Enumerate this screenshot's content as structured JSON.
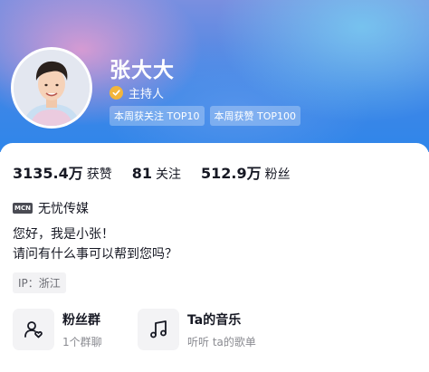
{
  "profile": {
    "name": "张大大",
    "verified_label": "主持人",
    "tags": [
      "本周获关注 TOP10",
      "本周获赞 TOP100"
    ]
  },
  "stats": [
    {
      "value": "3135.4万",
      "label": "获赞"
    },
    {
      "value": "81",
      "label": "关注"
    },
    {
      "value": "512.9万",
      "label": "粉丝"
    }
  ],
  "org": {
    "icon_text": "MCN",
    "name": "无忧传媒"
  },
  "bio": {
    "line1": "您好，我是小张！",
    "line2": "请问有什么事可以帮到您吗？"
  },
  "ip": "IP：浙江",
  "entries": [
    {
      "title": "粉丝群",
      "subtitle": "1个群聊",
      "icon": "fan-group-icon"
    },
    {
      "title": "Ta的音乐",
      "subtitle": "听听 ta的歌单",
      "icon": "music-note-icon"
    }
  ],
  "colors": {
    "header_blue": "#2f86ea",
    "verified_gold": "#f2b53b"
  }
}
